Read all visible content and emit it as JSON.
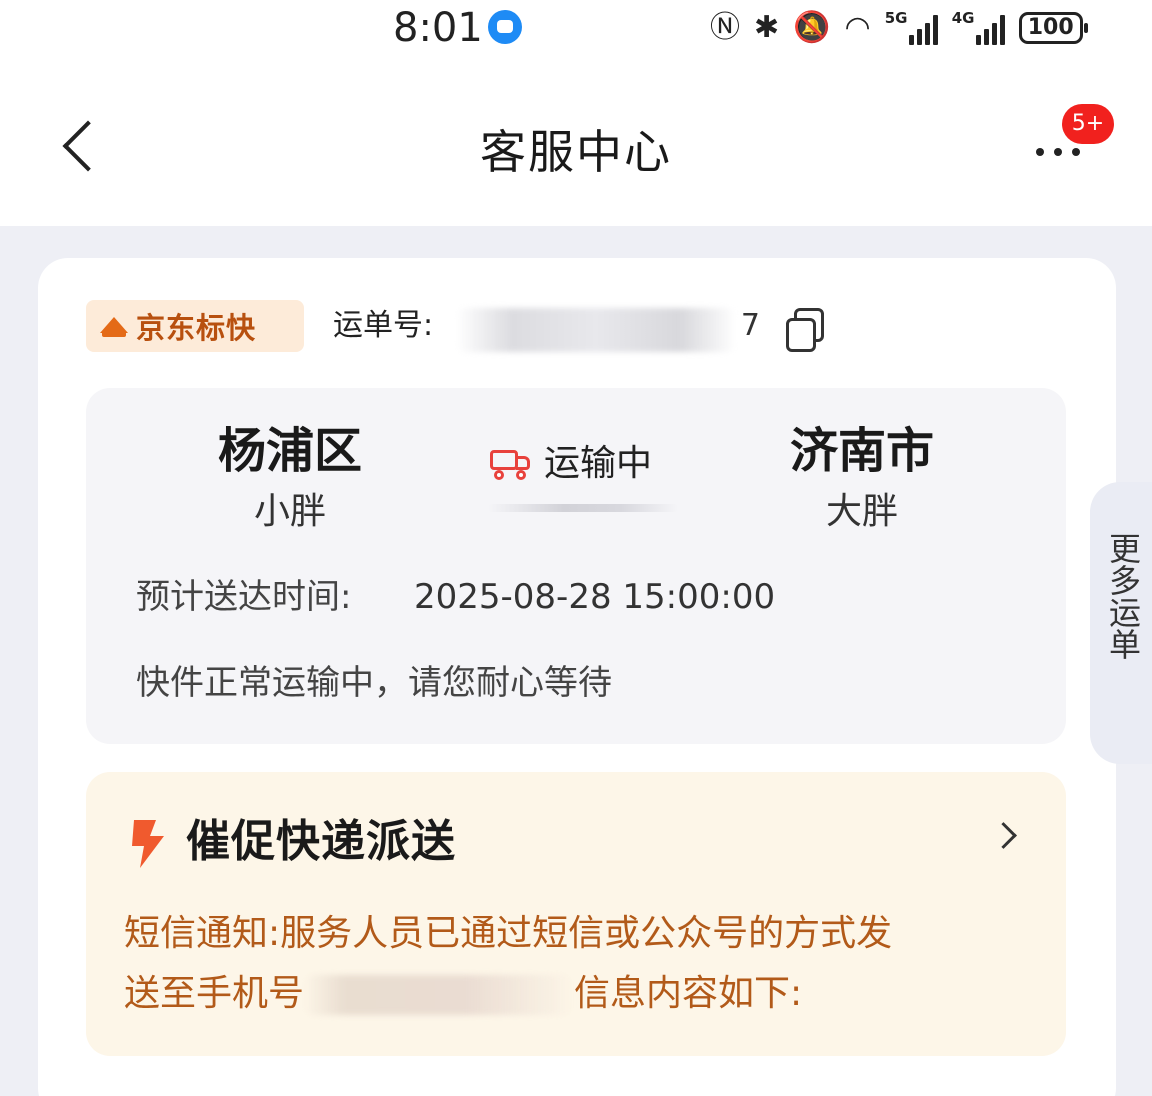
{
  "status_bar": {
    "time": "8:01",
    "network_1": "5G",
    "network_2": "4G",
    "battery": "100"
  },
  "nav": {
    "title": "客服中心",
    "badge": "5+"
  },
  "waybill": {
    "service_tag": "京东标快",
    "label": "运单号:",
    "number": "7"
  },
  "route": {
    "origin_city": "杨浦区",
    "origin_person": "小胖",
    "status": "运输中",
    "dest_city": "济南市",
    "dest_person": "大胖",
    "eta_label": "预计送达时间:",
    "eta_value": "2025-08-28 15:00:00",
    "note": "快件正常运输中，请您耐心等待"
  },
  "side_tab": {
    "label": "更多运单"
  },
  "urge": {
    "title": "催促快递派送",
    "message_line1": "短信通知:服务人员已通过短信或公众号的方式发",
    "message_line2_prefix": "送至手机号",
    "message_line2_suffix": "信息内容如下:"
  },
  "colors": {
    "accent_orange": "#b25a19",
    "tag_orange": "#e46a17",
    "badge_red": "#f1211e",
    "truck_red": "#e8413c"
  }
}
